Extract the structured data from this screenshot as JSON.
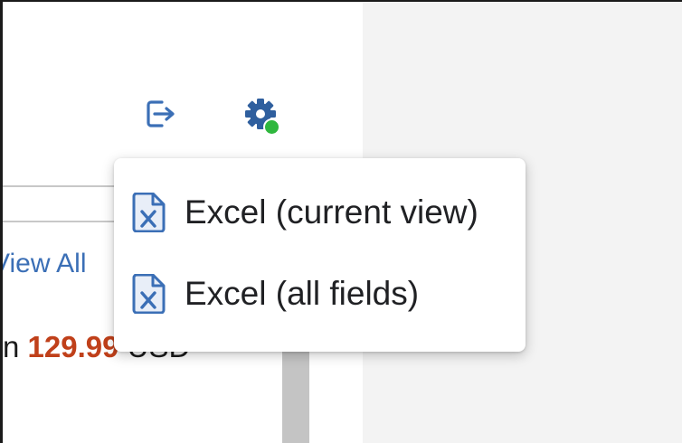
{
  "toolbar": {
    "export_icon": "export-icon",
    "settings_icon": "gear-icon",
    "settings_status_color": "#2fb73e"
  },
  "background": {
    "view_all_link": "View All",
    "price_prefix": "n",
    "price_amount": "129.99",
    "price_currency": "USD",
    "price_color": "#c0401a",
    "link_color": "#3b6fb6"
  },
  "export_menu": {
    "items": [
      {
        "label": "Excel (current view)",
        "icon": "excel-file-icon"
      },
      {
        "label": "Excel (all fields)",
        "icon": "excel-file-icon"
      }
    ],
    "icon_color": "#3b6fb6"
  }
}
